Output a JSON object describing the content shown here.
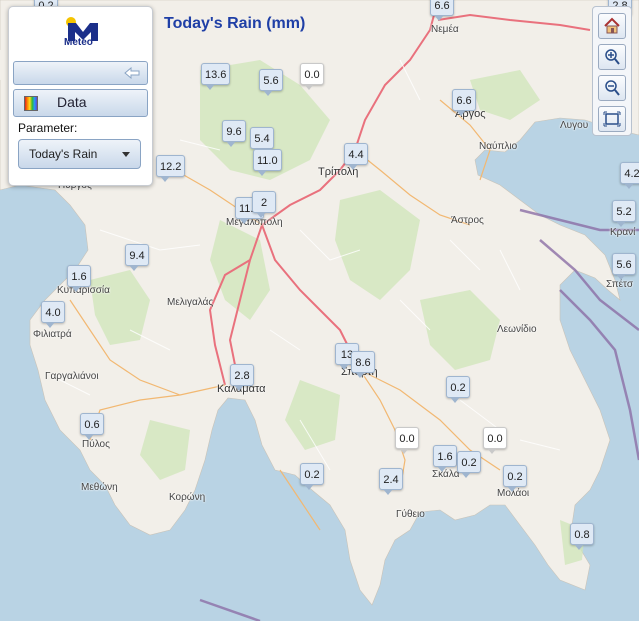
{
  "app": {
    "logo_text": "Meteo",
    "title": "Today's Rain (mm)"
  },
  "panel": {
    "data_label": "Data",
    "parameter_label": "Parameter:",
    "parameter_value": "Today's Rain"
  },
  "tools": [
    "home-icon",
    "zoom-in-icon",
    "zoom-out-icon",
    "zoom-extent-icon"
  ],
  "colors": {
    "sea": "#b9d3e4",
    "land": "#f2efe9",
    "road_primary": "#e9717d",
    "border": "#8c6fa6",
    "title": "#1f3fa6"
  },
  "stations": {
    "s1": "0.2",
    "s2": "6.6",
    "s3": "2.8",
    "s4": "13.6",
    "s5": "5.6",
    "s6": "0.0",
    "s7": "6.6",
    "s8": "9.6",
    "s9": "5.4",
    "s10": "11.0",
    "s11": "12.2",
    "s12": "4.4",
    "s13": "4.2",
    "s14": "11.4",
    "s15": "2",
    "s16": "5.2",
    "s17": "9.4",
    "s18": "5.6",
    "s19": "1.6",
    "s20": "4.0",
    "s21": "13",
    "s22": "8.6",
    "s23": "2.8",
    "s24": "0.2",
    "s25": "0.6",
    "s26": "0.0",
    "s27": "0.0",
    "s28": "1.6",
    "s29": "0.2",
    "s30": "0.2",
    "s31": "0.2",
    "s32": "2.4",
    "s33": "0.8"
  },
  "places": {
    "nemea": "Νεμέα",
    "tripoli": "Τρίπολη",
    "argos": "Άργος",
    "lygou": "Λυγου",
    "nafplio": "Ναύπλιο",
    "astros": "Άστρος",
    "megalopoli": "Μεγαλόπολη",
    "kranidi": "Κρανί",
    "spetses": "Σπέτσ",
    "kyparissia": "Κυπαρισσία",
    "meligalas": "Μελιγαλάς",
    "filiatra": "Φιλιατρά",
    "leonidio": "Λεωνίδιο",
    "gargalianoi": "Γαργαλιάνοι",
    "kalamata": "Καλαμάτα",
    "sparti": "Σπάρτη",
    "pylos": "Πύλος",
    "skala": "Σκάλα",
    "methoni": "Μεθώνη",
    "koroni": "Κορώνη",
    "molaoi": "Μολάοι",
    "gytheio": "Γύθειο",
    "pyrgos": "Πύργος"
  }
}
